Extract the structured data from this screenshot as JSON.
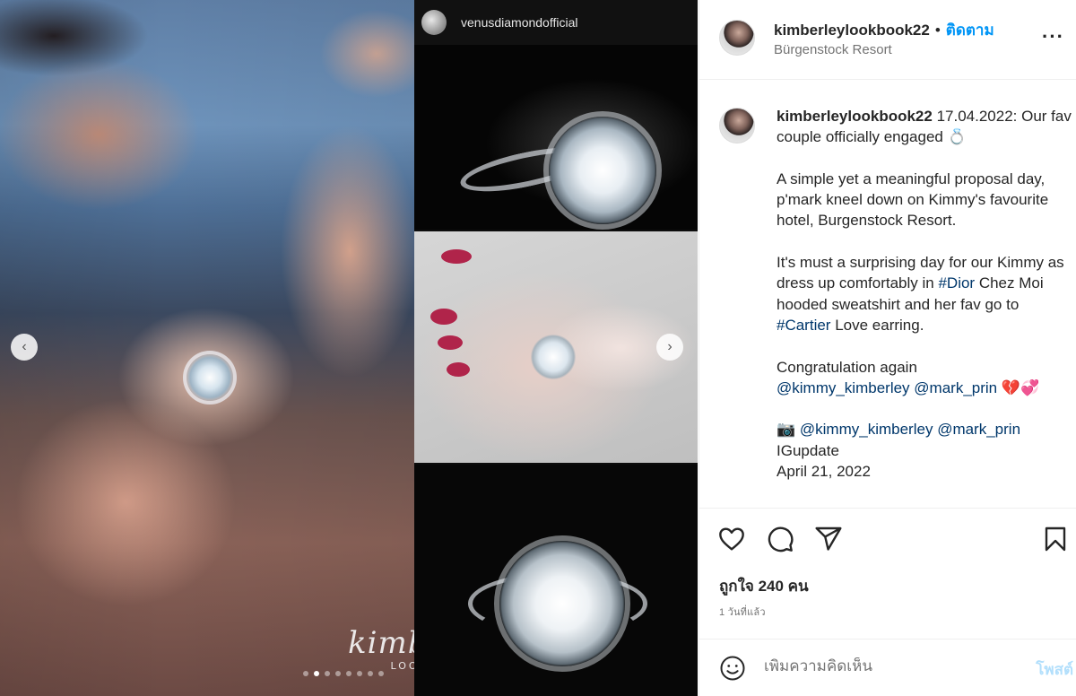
{
  "media": {
    "collage_handle": "venusdiamondofficial",
    "watermark_line1": "kimberley",
    "watermark_line2": "LOOKBOOK",
    "prev_label": "‹",
    "next_label": "›",
    "slide_count": 8,
    "active_slide": 1
  },
  "header": {
    "username": "kimberleylookbook22",
    "separator": "•",
    "follow_label": "ติดตาม",
    "location": "Bürgenstock Resort",
    "more_label": "···"
  },
  "caption": {
    "username": "kimberleylookbook22",
    "line1": " 17.04.2022: Our fav couple officially engaged 💍",
    "para2": "A simple yet a meaningful proposal day, p'mark kneel down on Kimmy's favourite hotel, Burgenstock Resort.",
    "para3_a": "It's must a surprising day for our Kimmy as dress up comfortably in ",
    "tag_dior": "#Dior",
    "para3_b": " Chez Moi hooded sweatshirt and her fav go to ",
    "tag_cartier": "#Cartier",
    "para3_c": " Love earring.",
    "congrats": "Congratulation again",
    "mention1": "@kimmy_kimberley",
    "mention2": "@mark_prin",
    "hearts": " 💔💞",
    "camera": "📷 ",
    "mention3": "@kimmy_kimberley",
    "mention4": "@mark_prin",
    "credit": "IGupdate",
    "date": "April 21, 2022"
  },
  "actions": {
    "likes": "ถูกใจ 240 คน",
    "ago": "1 วันที่แล้ว",
    "comment_placeholder": "เพิ่มความคิดเห็น",
    "post_label": "โพสต์"
  },
  "icons": {
    "like": "heart-icon",
    "comment": "comment-icon",
    "share": "share-icon",
    "save": "bookmark-icon",
    "emoji": "emoji-icon"
  },
  "colors": {
    "accent": "#0095f6",
    "link": "#00376b",
    "post_disabled": "#b2dffc",
    "secondary_text": "#737373"
  }
}
